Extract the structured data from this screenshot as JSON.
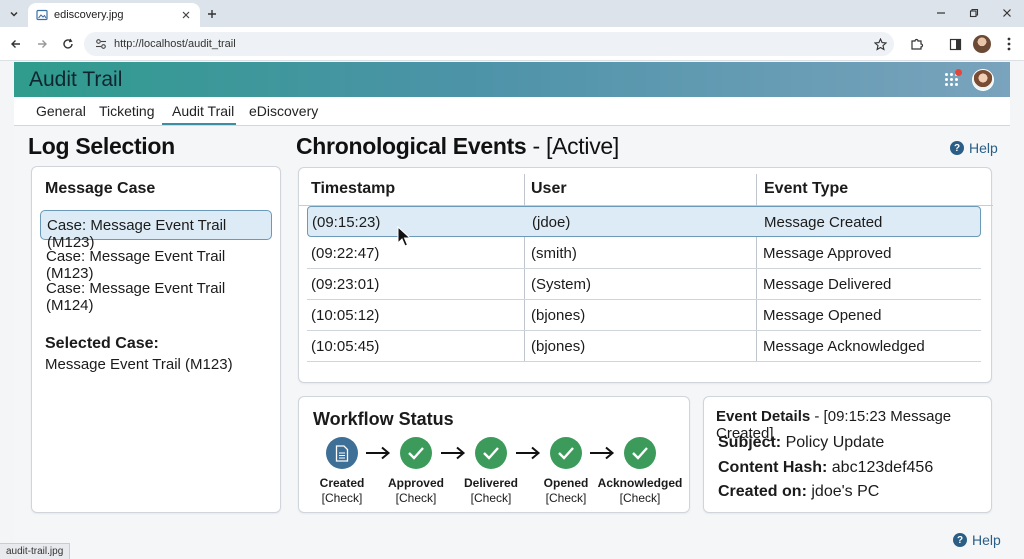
{
  "browser": {
    "tab_title": "ediscovery.jpg",
    "url": "http://localhost/audit_trail",
    "status_text": "audit-trail.jpg"
  },
  "app": {
    "title": "Audit Trail",
    "accent_color": "#3c8ea0",
    "tabs": [
      {
        "label": "General",
        "active": false
      },
      {
        "label": "Ticketing",
        "active": false
      },
      {
        "label": "Audit Trail",
        "active": true
      },
      {
        "label": "eDiscovery",
        "active": false
      }
    ]
  },
  "log_selection": {
    "title": "Log Selection",
    "heading": "Message Case",
    "cases": [
      {
        "label": "Case: Message Event Trail (M123)",
        "selected": true
      },
      {
        "label": "Case: Message Event Trail (M123)",
        "selected": false
      },
      {
        "label": "Case: Message Event Trail (M124)",
        "selected": false
      }
    ],
    "selected_label": "Selected Case:",
    "selected_value": "Message Event Trail (M123)"
  },
  "events": {
    "title": "Chronological Events",
    "status": "- [Active]",
    "help": "Help",
    "columns": [
      "Timestamp",
      "User",
      "Event Type"
    ],
    "rows": [
      {
        "timestamp": "(09:15:23)",
        "user": "(jdoe)",
        "event": "Message Created",
        "selected": true
      },
      {
        "timestamp": "(09:22:47)",
        "user": "(smith)",
        "event": "Message Approved",
        "selected": false
      },
      {
        "timestamp": "(09:23:01)",
        "user": "(System)",
        "event": "Message Delivered",
        "selected": false
      },
      {
        "timestamp": "(10:05:12)",
        "user": "(bjones)",
        "event": "Message Opened",
        "selected": false
      },
      {
        "timestamp": "(10:05:45)",
        "user": "(bjones)",
        "event": "Message Acknowledged",
        "selected": false
      }
    ]
  },
  "workflow": {
    "title": "Workflow Status",
    "steps": [
      {
        "label": "Created",
        "check": "[Check]",
        "icon": "document-icon",
        "color": "#3e6f96"
      },
      {
        "label": "Approved",
        "check": "[Check]",
        "icon": "checkmark-icon",
        "color": "#3c9b5a"
      },
      {
        "label": "Delivered",
        "check": "[Check]",
        "icon": "checkmark-icon",
        "color": "#3c9b5a"
      },
      {
        "label": "Opened",
        "check": "[Check]",
        "icon": "checkmark-icon",
        "color": "#3c9b5a"
      },
      {
        "label": "Acknowledged",
        "check": "[Check]",
        "icon": "checkmark-icon",
        "color": "#3c9b5a"
      }
    ]
  },
  "details": {
    "title": "Event Details",
    "title_suffix": "- [09:15:23 Message Created]",
    "subject_label": "Subject:",
    "subject_value": "Policy Update",
    "hash_label": "Content Hash:",
    "hash_value": "abc123def456",
    "created_label": "Created on:",
    "created_value": "jdoe's PC",
    "help": "Help"
  }
}
